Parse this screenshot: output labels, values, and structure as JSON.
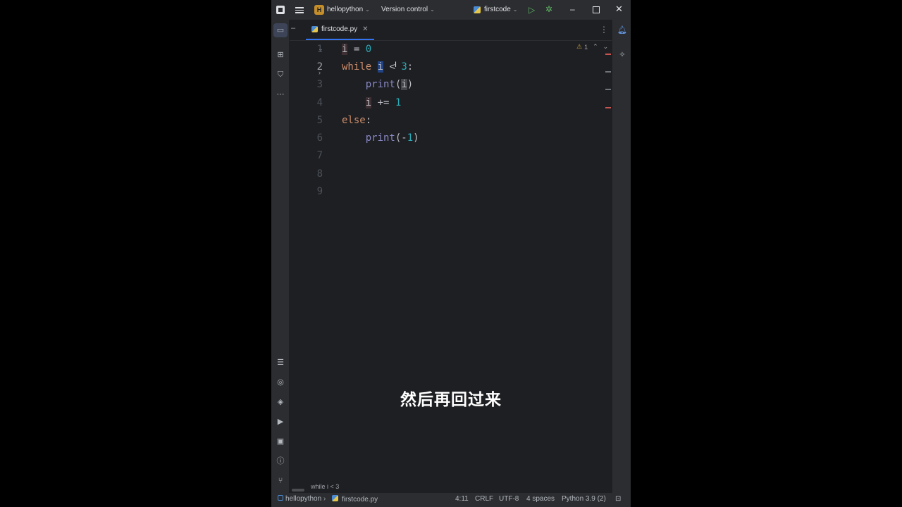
{
  "titlebar": {
    "project_badge": "H",
    "project_name": "hellopython",
    "version_control": "Version control",
    "run_config": "firstcode"
  },
  "tab": {
    "file_name": "firstcode.py"
  },
  "editor": {
    "line_numbers": [
      "1",
      "2",
      "3",
      "4",
      "5",
      "6",
      "7",
      "8",
      "9"
    ],
    "current_line": "2",
    "inspections": {
      "warnings": "1"
    }
  },
  "breadcrumb": "while i < 3",
  "subtitle": "然后再回过来",
  "statusbar": {
    "project": "hellopython",
    "file": "firstcode.py",
    "position": "4:11",
    "line_sep": "CRLF",
    "encoding": "UTF-8",
    "indent": "4 spaces",
    "interpreter": "Python 3.9 (2)"
  },
  "colors": {
    "accent": "#3574f0",
    "keyword": "#cf8e6d",
    "number": "#2aacb8",
    "builtin": "#8888c6",
    "run_green": "#5fb865"
  }
}
